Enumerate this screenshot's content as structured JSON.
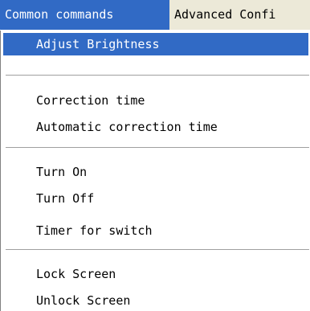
{
  "menubar": {
    "menus": [
      "Common commands",
      "Advanced Confi"
    ]
  },
  "dropdown": {
    "items": [
      "Adjust Brightness",
      "Correction time",
      "Automatic correction time",
      "Turn On",
      "Turn Off",
      "Timer for switch",
      "Lock Screen",
      "Unlock Screen"
    ]
  },
  "colors": {
    "highlight": "#316ac5",
    "menubar_bg": "#ece9d8",
    "separator": "#a0a0a0"
  }
}
